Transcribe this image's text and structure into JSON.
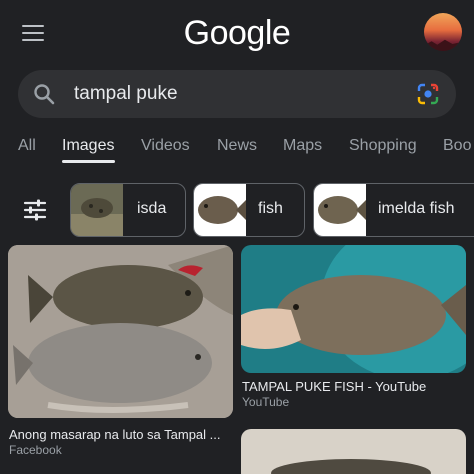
{
  "header": {
    "logo_text": "Google",
    "menu_icon": "hamburger-menu-icon",
    "avatar_icon": "profile-avatar"
  },
  "search": {
    "query": "tampal puke",
    "search_icon": "search-icon",
    "lens_icon": "google-lens-icon"
  },
  "tabs": [
    {
      "label": "All"
    },
    {
      "label": "Images"
    },
    {
      "label": "Videos"
    },
    {
      "label": "News"
    },
    {
      "label": "Maps"
    },
    {
      "label": "Shopping"
    },
    {
      "label": "Boo"
    }
  ],
  "active_tab": "Images",
  "chips": [
    {
      "label": "isda"
    },
    {
      "label": "fish"
    },
    {
      "label": "imelda fish"
    }
  ],
  "results": [
    {
      "title": "Anong masarap na luto sa Tampal ...",
      "source": "Facebook"
    },
    {
      "title": "TAMPAL PUKE FISH - YouTube",
      "source": "YouTube"
    },
    {
      "title": "",
      "source": ""
    }
  ],
  "colors": {
    "background": "#202124",
    "search_bg": "#303134",
    "text": "#e8eaed",
    "muted": "#9aa0a6"
  }
}
